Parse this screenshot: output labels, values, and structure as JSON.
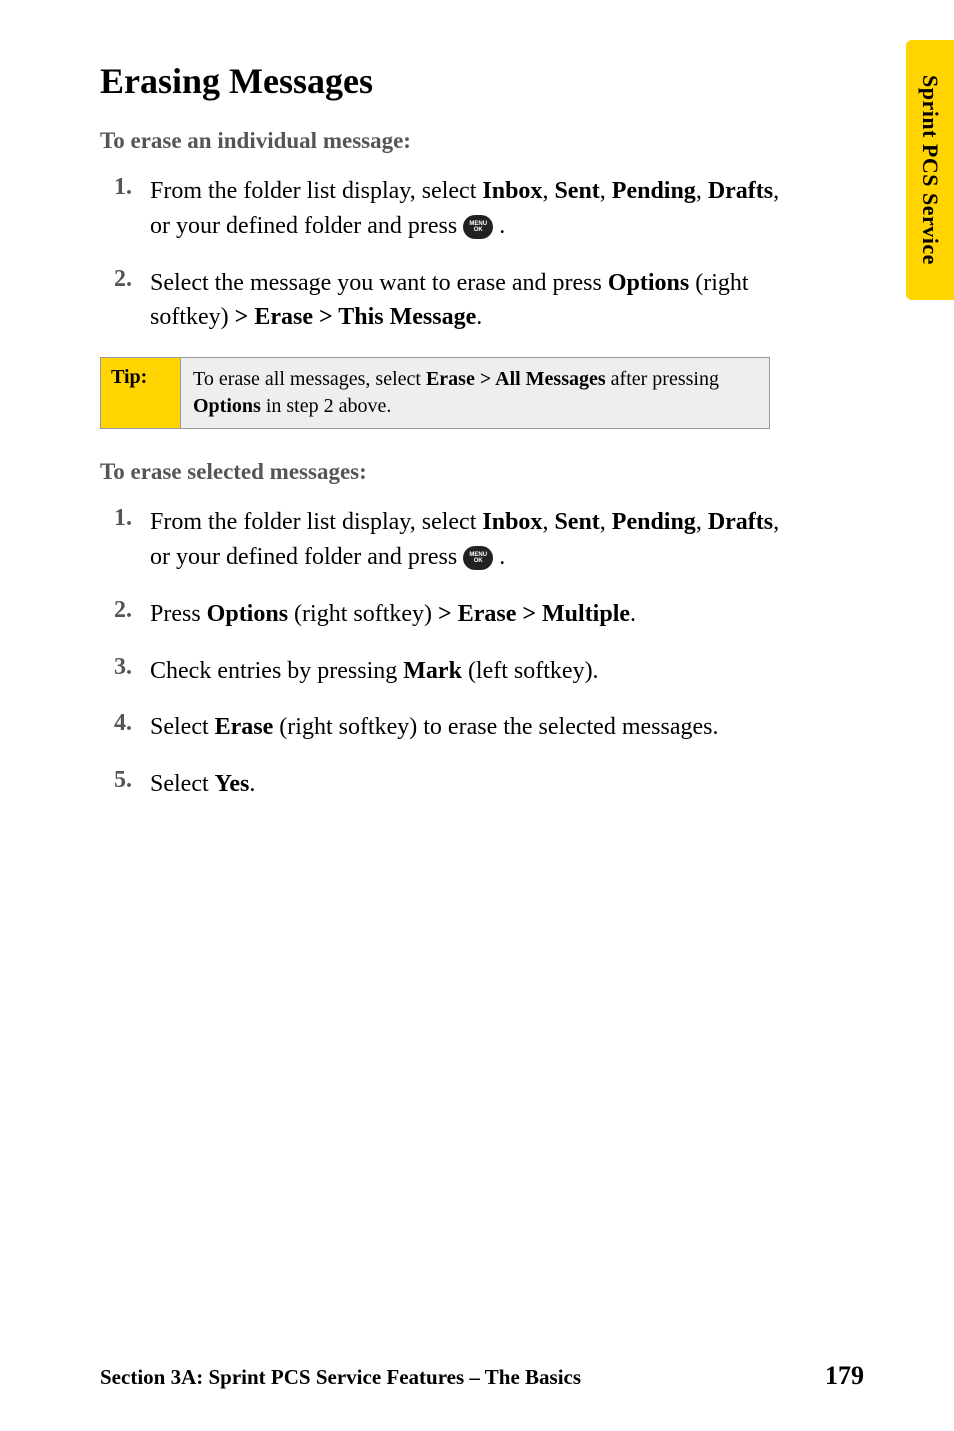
{
  "sideTab": "Sprint PCS Service",
  "heading": "Erasing Messages",
  "section1": {
    "lead": "To erase an individual message:",
    "steps": [
      {
        "num": "1.",
        "before": "From the folder list display, select ",
        "b1": "Inbox",
        "c1": ", ",
        "b2": "Sent",
        "c2": ", ",
        "b3": "Pending",
        "c3": ", ",
        "b4": "Drafts",
        "after": ", or your defined folder and press ",
        "tail": " ."
      },
      {
        "num": "2.",
        "before": "Select the message you want to erase and press ",
        "b1": "Options",
        "mid": " (right softkey) ",
        "b2": "> Erase > This Message",
        "tail": "."
      }
    ]
  },
  "tip": {
    "label": "Tip:",
    "t1": "To erase all messages, select ",
    "b1": "Erase > All Messages",
    "t2": " after pressing ",
    "b2": "Options",
    "t3": " in step 2 above."
  },
  "section2": {
    "lead": "To erase selected messages:",
    "steps": [
      {
        "num": "1.",
        "before": "From the folder list display, select ",
        "b1": "Inbox",
        "c1": ", ",
        "b2": "Sent",
        "c2": ", ",
        "b3": "Pending",
        "c3": ", ",
        "b4": "Drafts",
        "after": ", or your defined folder and press ",
        "tail": " ."
      },
      {
        "num": "2.",
        "t1": "Press ",
        "b1": "Options",
        "t2": " (right softkey) ",
        "b2": "> Erase > Multiple",
        "t3": "."
      },
      {
        "num": "3.",
        "t1": "Check entries by pressing ",
        "b1": "Mark",
        "t2": " (left softkey)."
      },
      {
        "num": "4.",
        "t1": "Select ",
        "b1": "Erase",
        "t2": " (right softkey) to erase the selected messages."
      },
      {
        "num": "5.",
        "t1": "Select ",
        "b1": "Yes",
        "t2": "."
      }
    ]
  },
  "footer": {
    "text": "Section 3A: Sprint PCS Service Features – The Basics",
    "page": "179"
  },
  "menuIcon": {
    "top": "MENU",
    "bottom": "OK"
  }
}
